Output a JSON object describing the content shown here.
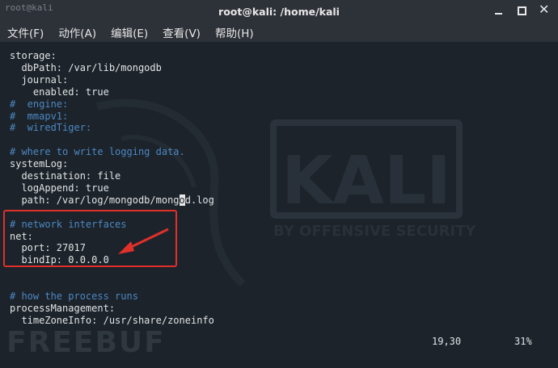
{
  "window": {
    "watermark_top": "root@kali",
    "title": "root@kali: /home/kali"
  },
  "menu": [
    "文件(F)",
    "动作(A)",
    "编辑(E)",
    "查看(V)",
    "帮助(H)"
  ],
  "editor": {
    "lines": [
      {
        "text": "storage:",
        "comment": false
      },
      {
        "text": "  dbPath: /var/lib/mongodb",
        "comment": false
      },
      {
        "text": "  journal:",
        "comment": false
      },
      {
        "text": "    enabled: true",
        "comment": false
      },
      {
        "text": "#  engine:",
        "comment": true
      },
      {
        "text": "#  mmapv1:",
        "comment": true
      },
      {
        "text": "#  wiredTiger:",
        "comment": true
      },
      {
        "text": "",
        "comment": false
      },
      {
        "text": "# where to write logging data.",
        "comment": true
      },
      {
        "text": "systemLog:",
        "comment": false
      },
      {
        "text": "  destination: file",
        "comment": false
      },
      {
        "text": "  logAppend: true",
        "comment": false
      },
      {
        "text": "  path: /var/log/mongodb/mongod.log",
        "comment": false,
        "cursor_col": 29
      },
      {
        "text": "",
        "comment": false
      },
      {
        "text": "# network interfaces",
        "comment": true
      },
      {
        "text": "net:",
        "comment": false
      },
      {
        "text": "  port: 27017",
        "comment": false
      },
      {
        "text": "  bindIp: 0.0.0.0",
        "comment": false
      },
      {
        "text": "",
        "comment": false
      },
      {
        "text": "",
        "comment": false
      },
      {
        "text": "# how the process runs",
        "comment": true
      },
      {
        "text": "processManagement:",
        "comment": false
      },
      {
        "text": "  timeZoneInfo: /usr/share/zoneinfo",
        "comment": false
      }
    ]
  },
  "status": {
    "position": "19,30",
    "percent": "31%"
  },
  "background": {
    "logo_text": "KALI",
    "logo_subtext": "BY OFFENSIVE SECURITY"
  },
  "watermark": "FREEBUF",
  "colors": {
    "comment": "#4d88c4",
    "text": "#e2e4e6",
    "highlight": "#e0302a"
  }
}
